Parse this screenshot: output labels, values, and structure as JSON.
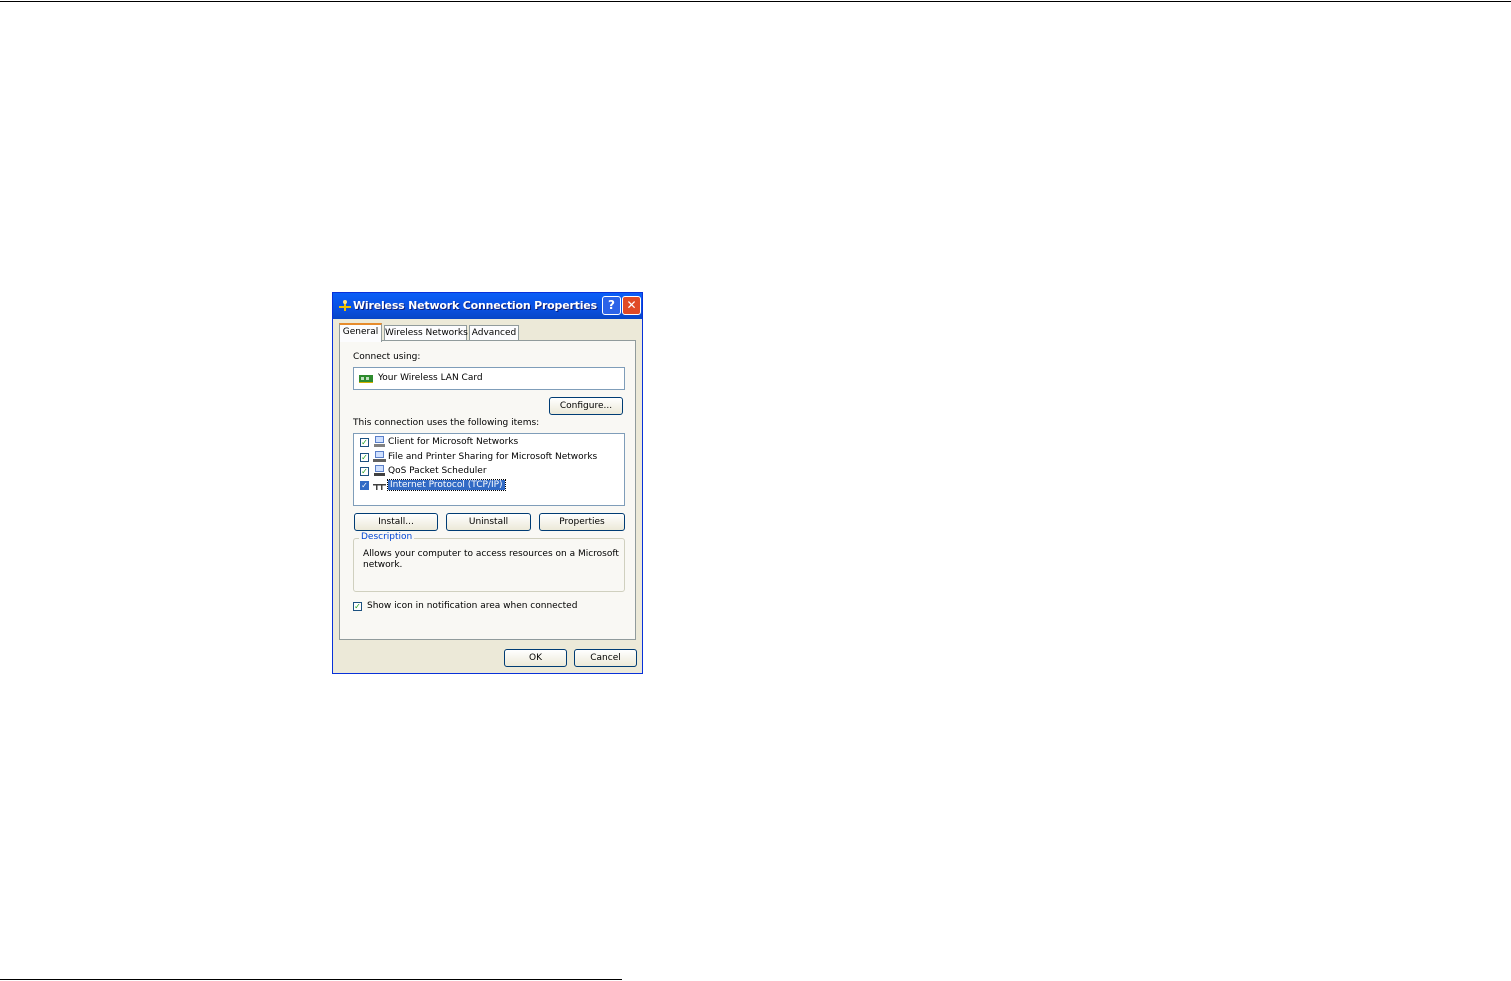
{
  "window": {
    "title": "Wireless Network Connection Properties",
    "help_glyph": "?",
    "close_glyph": "✕"
  },
  "tabs": [
    {
      "label": "General",
      "active": true
    },
    {
      "label": "Wireless Networks",
      "active": false
    },
    {
      "label": "Advanced",
      "active": false
    }
  ],
  "general": {
    "connect_using_label": "Connect using:",
    "adapter_name": "Your Wireless LAN Card",
    "configure_label": "Configure...",
    "items_label": "This connection uses the following items:",
    "items": [
      {
        "label": "Client for Microsoft Networks",
        "checked": true,
        "icon": "network-client-icon"
      },
      {
        "label": "File and Printer Sharing for Microsoft Networks",
        "checked": true,
        "icon": "file-printer-sharing-icon"
      },
      {
        "label": "QoS Packet Scheduler",
        "checked": true,
        "icon": "qos-scheduler-icon"
      },
      {
        "label": "Internet Protocol (TCP/IP)",
        "checked": true,
        "selected": true,
        "icon": "protocol-icon"
      }
    ],
    "install_label": "Install...",
    "uninstall_label": "Uninstall",
    "properties_label": "Properties",
    "description_legend": "Description",
    "description_text_line1": "Allows your computer to access resources on a Microsoft",
    "description_text_line2": "network.",
    "show_icon_label": "Show icon in notification area when connected",
    "show_icon_checked": true
  },
  "footer": {
    "ok_label": "OK",
    "cancel_label": "Cancel"
  },
  "colors": {
    "titlebar": "#0a50e0",
    "dialog_bg": "#ece9d8",
    "selection": "#316ac5",
    "tab_accent": "#e68b2c"
  }
}
